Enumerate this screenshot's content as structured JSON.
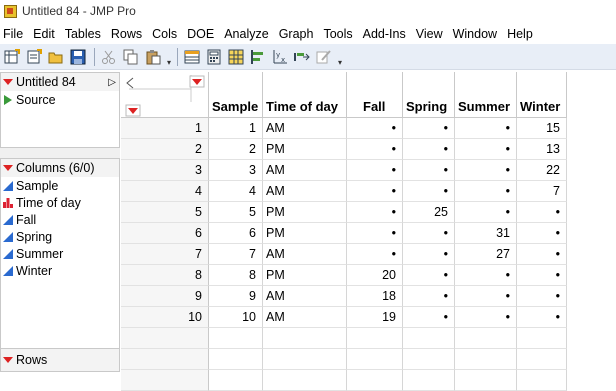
{
  "window": {
    "title": "Untitled 84 - JMP Pro"
  },
  "menu": [
    "File",
    "Edit",
    "Tables",
    "Rows",
    "Cols",
    "DOE",
    "Analyze",
    "Graph",
    "Tools",
    "Add-Ins",
    "View",
    "Window",
    "Help"
  ],
  "toolbar": {
    "icons": [
      "new-data-table-icon",
      "new-script-icon",
      "open-icon",
      "save-icon",
      "cut-icon",
      "copy-icon",
      "paste-icon",
      "data-table-icon",
      "calculator-icon",
      "grid-icon",
      "align-icon",
      "xy-plot-icon",
      "arrow-icon",
      "edit-icon"
    ]
  },
  "left_panel": {
    "table_name": "Untitled 84",
    "source_label": "Source",
    "columns_header": "Columns (6/0)",
    "columns": [
      {
        "name": "Sample",
        "type": "continuous"
      },
      {
        "name": "Time of day",
        "type": "nominal"
      },
      {
        "name": "Fall",
        "type": "continuous"
      },
      {
        "name": "Spring",
        "type": "continuous"
      },
      {
        "name": "Summer",
        "type": "continuous"
      },
      {
        "name": "Winter",
        "type": "continuous"
      }
    ],
    "rows_header": "Rows"
  },
  "table": {
    "headers": [
      "Sample",
      "Time of day",
      "Fall",
      "Spring",
      "Summer",
      "Winter"
    ],
    "rows": [
      {
        "n": "1",
        "cells": [
          "1",
          "AM",
          "•",
          "•",
          "•",
          "15"
        ]
      },
      {
        "n": "2",
        "cells": [
          "2",
          "PM",
          "•",
          "•",
          "•",
          "13"
        ]
      },
      {
        "n": "3",
        "cells": [
          "3",
          "AM",
          "•",
          "•",
          "•",
          "22"
        ]
      },
      {
        "n": "4",
        "cells": [
          "4",
          "AM",
          "•",
          "•",
          "•",
          "7"
        ]
      },
      {
        "n": "5",
        "cells": [
          "5",
          "PM",
          "•",
          "25",
          "•",
          "•"
        ]
      },
      {
        "n": "6",
        "cells": [
          "6",
          "PM",
          "•",
          "•",
          "31",
          "•"
        ]
      },
      {
        "n": "7",
        "cells": [
          "7",
          "AM",
          "•",
          "•",
          "27",
          "•"
        ]
      },
      {
        "n": "8",
        "cells": [
          "8",
          "PM",
          "20",
          "•",
          "•",
          "•"
        ]
      },
      {
        "n": "9",
        "cells": [
          "9",
          "AM",
          "18",
          "•",
          "•",
          "•"
        ]
      },
      {
        "n": "10",
        "cells": [
          "10",
          "AM",
          "19",
          "•",
          "•",
          "•"
        ]
      }
    ]
  }
}
